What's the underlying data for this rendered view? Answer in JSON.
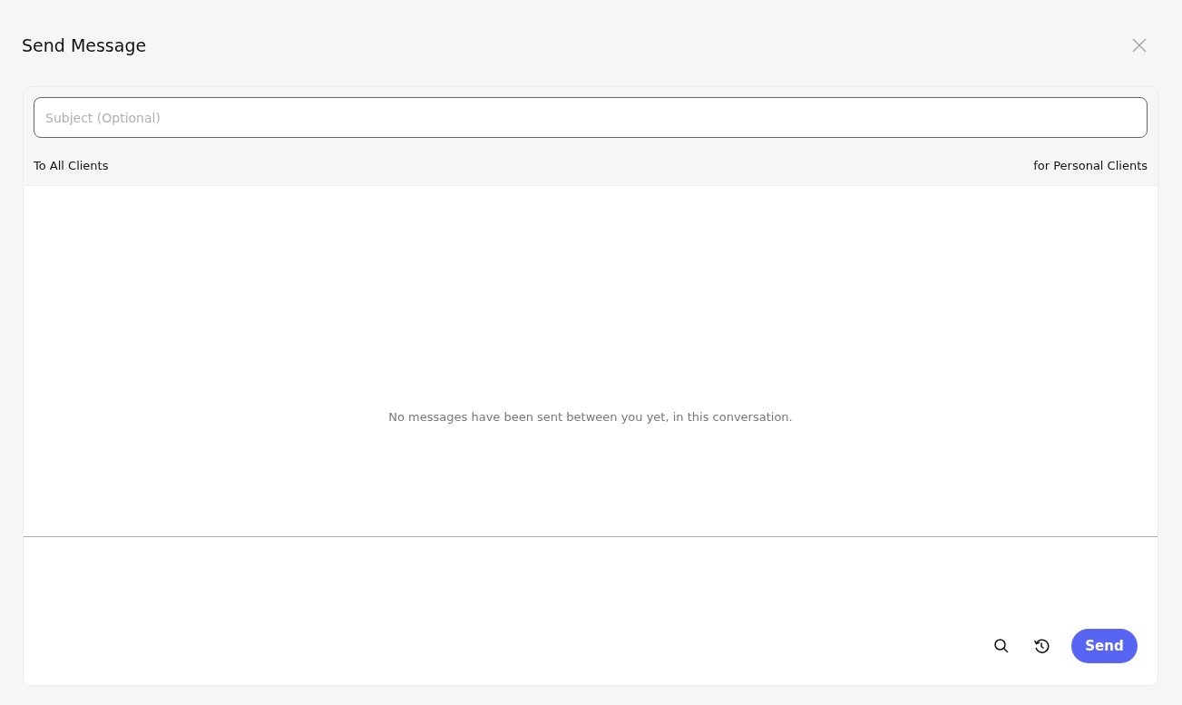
{
  "dialog": {
    "title": "Send Message"
  },
  "subject": {
    "placeholder": "Subject (Optional)"
  },
  "audience": {
    "left": "To All Clients",
    "right": "for Personal Clients"
  },
  "conversation": {
    "empty_text": "No messages have been sent between you yet, in this conversation."
  },
  "footer": {
    "send_label": "Send"
  }
}
